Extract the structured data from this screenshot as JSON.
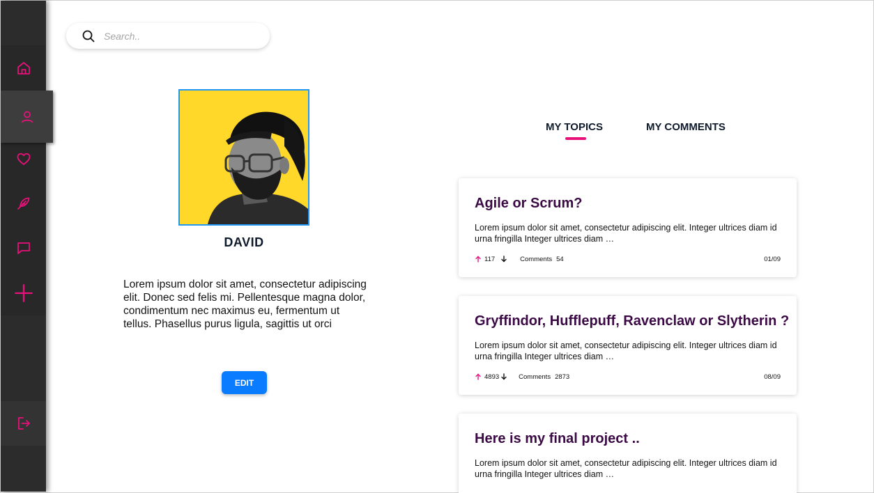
{
  "search": {
    "placeholder": "Search.."
  },
  "sidebar": {
    "items": [
      {
        "icon": "home-icon",
        "active": false
      },
      {
        "icon": "user-icon",
        "active": true
      },
      {
        "icon": "heart-icon",
        "active": false
      },
      {
        "icon": "feather-icon",
        "active": false
      },
      {
        "icon": "chat-icon",
        "active": false
      },
      {
        "icon": "plus-icon",
        "active": false
      }
    ],
    "logout_icon": "logout-icon",
    "accent": "#e8107a"
  },
  "profile": {
    "name": "DAVID",
    "bio": "Lorem ipsum dolor sit amet, consectetur adipiscing elit. Donec sed felis mi. Pellentesque magna dolor, condimentum nec maximus eu, fermentum ut tellus. Phasellus purus ligula, sagittis ut orci",
    "edit_label": "EDIT"
  },
  "tabs": [
    {
      "label": "MY TOPICS",
      "active": true
    },
    {
      "label": "MY COMMENTS",
      "active": false
    }
  ],
  "topics": [
    {
      "title": "Agile or Scrum?",
      "body": "Lorem ipsum dolor sit amet, consectetur adipiscing elit. Integer ultrices diam id urna fringilla Integer ultrices diam …",
      "upvotes": "117",
      "comments_label": "Comments",
      "comments": "54",
      "date": "01/09"
    },
    {
      "title": "Gryffindor, Hufflepuff, Ravenclaw or Slytherin ?",
      "body": "Lorem ipsum dolor sit amet, consectetur adipiscing elit. Integer ultrices diam id urna fringilla Integer ultrices diam …",
      "upvotes": "4893",
      "comments_label": "Comments",
      "comments": "2873",
      "date": "08/09"
    },
    {
      "title": "Here is my final project ..",
      "body": "Lorem ipsum dolor sit amet, consectetur adipiscing elit. Integer ultrices diam id urna fringilla Integer ultrices diam …"
    }
  ],
  "colors": {
    "brand_pink": "#e8107a",
    "primary_blue": "#0a7cff",
    "title_purple": "#3b0a45",
    "sidebar_bg": "#2c2c2c"
  }
}
